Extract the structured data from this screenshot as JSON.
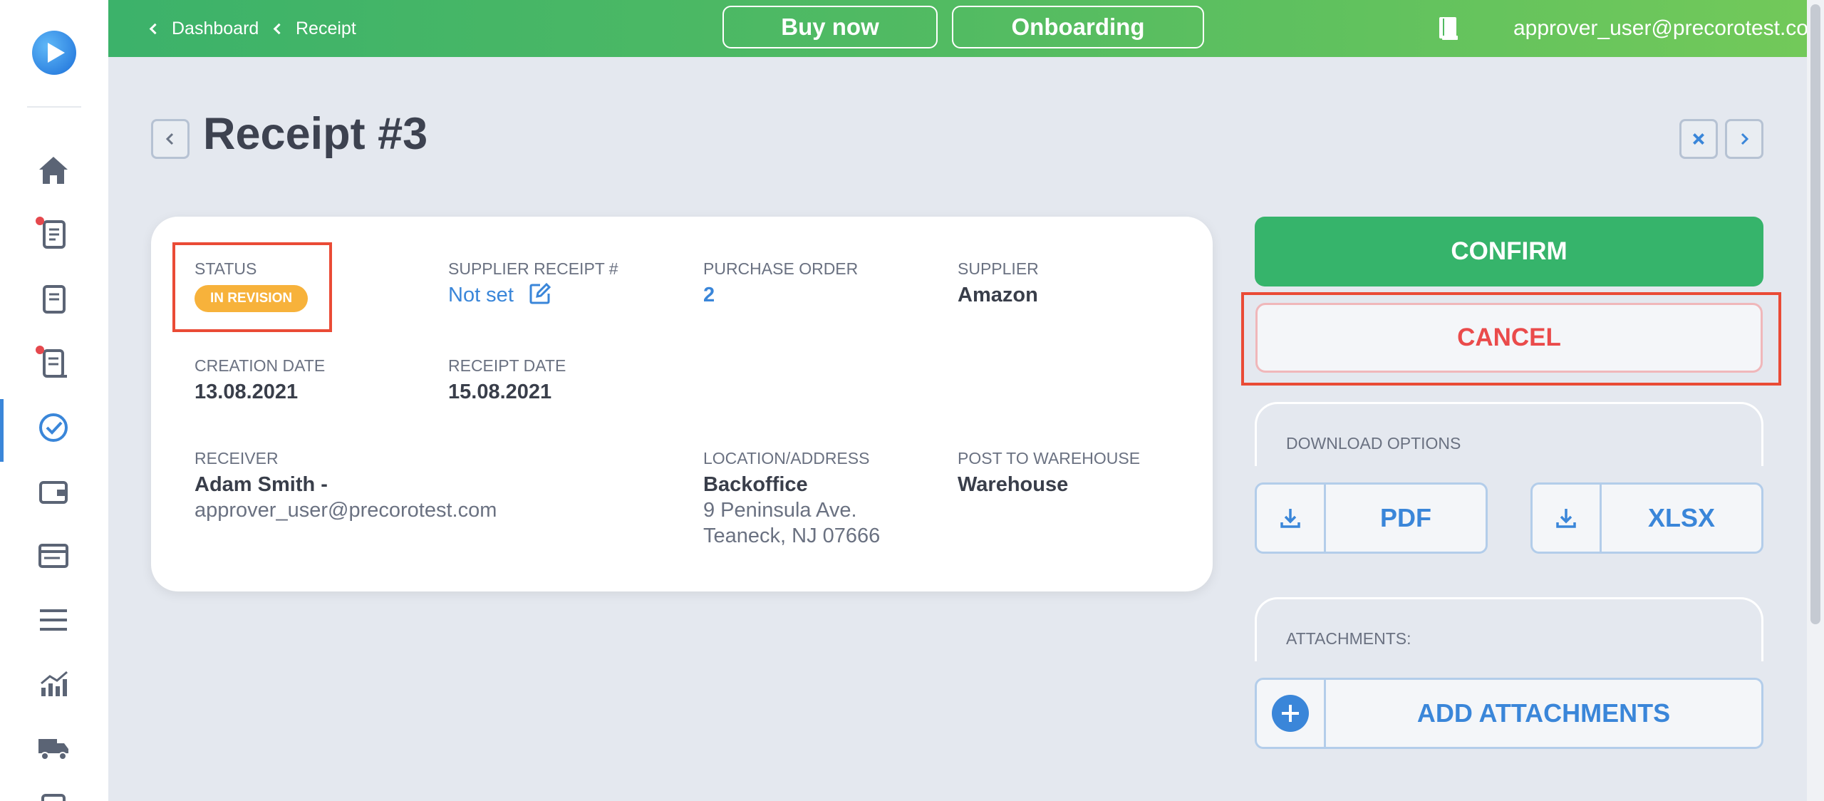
{
  "header": {
    "breadcrumbs": [
      "Dashboard",
      "Receipt"
    ],
    "buy_now": "Buy now",
    "onboarding": "Onboarding",
    "user_email": "approver_user@precorotest.com"
  },
  "sidebar": {
    "items": [
      {
        "icon": "home-icon"
      },
      {
        "icon": "requisitions-icon",
        "badge": true
      },
      {
        "icon": "purchase-orders-icon"
      },
      {
        "icon": "invoices-icon",
        "badge": true
      },
      {
        "icon": "receipts-check-icon",
        "active": true
      },
      {
        "icon": "wallet-icon"
      },
      {
        "icon": "card-icon"
      },
      {
        "icon": "menu-icon"
      },
      {
        "icon": "analytics-icon"
      },
      {
        "icon": "truck-icon"
      }
    ]
  },
  "page": {
    "title": "Receipt #3"
  },
  "details": {
    "status_label": "STATUS",
    "status_value": "IN REVISION",
    "supplier_receipt_label": "SUPPLIER RECEIPT #",
    "supplier_receipt_value": "Not set",
    "purchase_order_label": "PURCHASE ORDER",
    "purchase_order_value": "2",
    "supplier_label": "SUPPLIER",
    "supplier_value": "Amazon",
    "creation_date_label": "CREATION DATE",
    "creation_date_value": "13.08.2021",
    "receipt_date_label": "RECEIPT DATE",
    "receipt_date_value": "15.08.2021",
    "receiver_label": "RECEIVER",
    "receiver_name": "Adam Smith -",
    "receiver_email": "approver_user@precorotest.com",
    "location_label": "LOCATION/ADDRESS",
    "location_name": "Backoffice",
    "location_line1": "9 Peninsula Ave.",
    "location_line2": "Teaneck, NJ 07666",
    "warehouse_label": "POST TO WAREHOUSE",
    "warehouse_value": "Warehouse"
  },
  "actions": {
    "confirm": "CONFIRM",
    "cancel": "CANCEL",
    "download_title": "DOWNLOAD OPTIONS",
    "pdf": "PDF",
    "xlsx": "XLSX",
    "attachments_title": "ATTACHMENTS:",
    "add_attachments": "ADD ATTACHMENTS"
  },
  "colors": {
    "header_gradient_start": "#3cb26a",
    "header_gradient_end": "#72c95a",
    "accent_blue": "#3a86d9",
    "confirm_green": "#36b46b",
    "cancel_red": "#ea4b4b",
    "status_orange": "#f7b23b",
    "highlight_red": "#ea4b36"
  }
}
